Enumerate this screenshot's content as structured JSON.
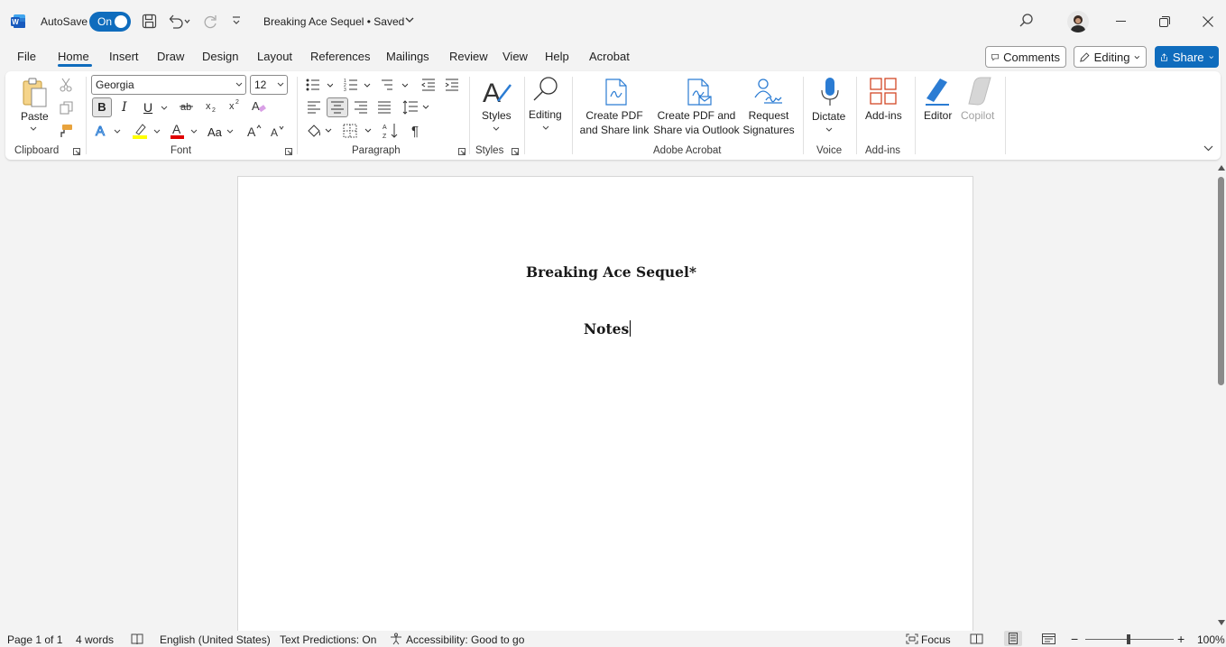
{
  "titlebar": {
    "app_icon": "word-icon",
    "autosave_label": "AutoSave",
    "autosave_state": "On",
    "doc_title": "Breaking Ace Sequel • Saved",
    "icons": [
      "save-icon",
      "undo-icon",
      "redo-icon",
      "customize-icon",
      "search-icon",
      "minimize-icon",
      "restore-icon",
      "close-icon"
    ]
  },
  "tabs": [
    "File",
    "Home",
    "Insert",
    "Draw",
    "Design",
    "Layout",
    "References",
    "Mailings",
    "Review",
    "View",
    "Help",
    "Acrobat"
  ],
  "active_tab": "Home",
  "right_buttons": {
    "comments": "Comments",
    "editing": "Editing",
    "share": "Share"
  },
  "ribbon": {
    "clipboard": {
      "paste": "Paste",
      "label": "Clipboard"
    },
    "font": {
      "name": "Georgia",
      "size": "12",
      "label": "Font",
      "bold": "B",
      "italic": "I",
      "underline": "U",
      "change_case": "Aa"
    },
    "paragraph": {
      "label": "Paragraph"
    },
    "styles": {
      "styles": "Styles",
      "label": "Styles"
    },
    "editing": {
      "editing": "Editing"
    },
    "adobe": {
      "create_pdf_share_line1": "Create PDF",
      "create_pdf_share_line2": "and Share link",
      "create_pdf_outlook_line1": "Create PDF and",
      "create_pdf_outlook_line2": "Share via Outlook",
      "request_sig_line1": "Request",
      "request_sig_line2": "Signatures",
      "label": "Adobe Acrobat"
    },
    "voice": {
      "dictate": "Dictate",
      "label": "Voice"
    },
    "addins": {
      "addins": "Add-ins",
      "label": "Add-ins"
    },
    "editor": "Editor",
    "copilot": "Copilot"
  },
  "document": {
    "title": "Breaking Ace Sequel*",
    "heading": "Notes"
  },
  "statusbar": {
    "page": "Page 1 of 1",
    "words": "4 words",
    "language": "English (United States)",
    "predictions": "Text Predictions: On",
    "accessibility": "Accessibility: Good to go",
    "focus": "Focus",
    "zoom": "100%"
  },
  "colors": {
    "accent": "#0f6cbd",
    "highlight": "#ffff00",
    "font_color": "#e00000"
  }
}
